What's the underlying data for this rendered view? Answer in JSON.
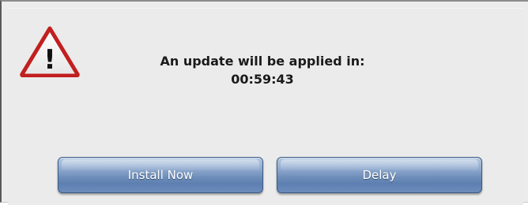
{
  "dialog": {
    "icon": "warning-icon",
    "icon_glyph": "!",
    "message": "An update will be applied in:",
    "countdown": "00:59:43"
  },
  "buttons": {
    "install_label": "Install Now",
    "delay_label": "Delay"
  },
  "colors": {
    "button_accent": "#6f8fbb",
    "warning_red": "#c21f1f",
    "dialog_background": "#ececec"
  }
}
